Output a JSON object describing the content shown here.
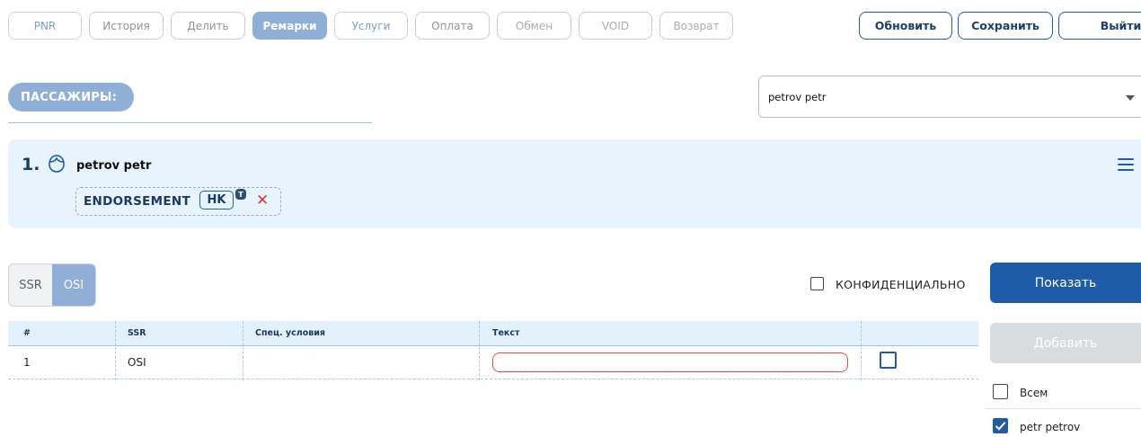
{
  "tabs": [
    {
      "label": "PNR"
    },
    {
      "label": "История"
    },
    {
      "label": "Делить"
    },
    {
      "label": "Ремарки"
    },
    {
      "label": "Услуги"
    },
    {
      "label": "Оплата"
    },
    {
      "label": "Обмен"
    },
    {
      "label": "VOID"
    },
    {
      "label": "Возврат"
    }
  ],
  "active_tab": "Ремарки",
  "actions": {
    "refresh": "Обновить",
    "save": "Сохранить",
    "exit": "Выйти"
  },
  "passengers": {
    "heading": "ПАССАЖИРЫ:",
    "selected": "petrov petr",
    "list": [
      {
        "number": "1.",
        "name": "petrov petr",
        "tag": "ENDORSEMENT",
        "status": "HK",
        "status_badge": "T"
      }
    ]
  },
  "remarks": {
    "type_toggle": {
      "options": [
        "SSR",
        "OSI"
      ],
      "selected": "OSI"
    },
    "confidential_label": "КОНФИДЕНЦИАЛЬНО",
    "confidential_checked": false,
    "show_button": "Показать",
    "add_button": "Добавить",
    "table": {
      "columns": [
        "#",
        "SSR",
        "Спец. условия",
        "Текст"
      ],
      "rows": [
        {
          "num": "1",
          "ssr": "OSI",
          "conditions": "",
          "text": "",
          "checked": false
        }
      ]
    },
    "recipients": [
      {
        "label": "Всем",
        "checked": false
      },
      {
        "label": "petr petrov",
        "checked": true
      }
    ]
  },
  "colors": {
    "primary": "#1f5ca8",
    "accent_light": "#8fafd6",
    "card_bg": "#e8f4fd",
    "error": "#e34b4b"
  }
}
